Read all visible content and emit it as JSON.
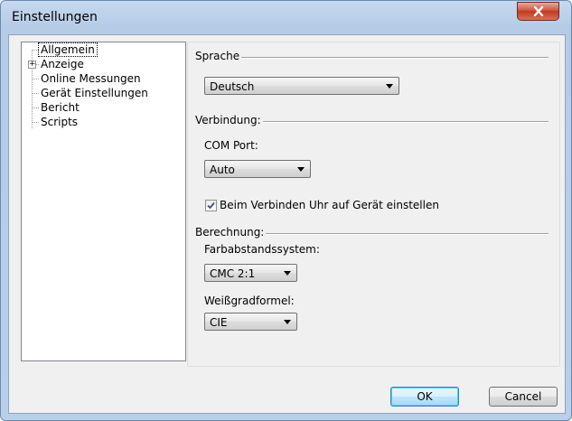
{
  "window": {
    "title": "Einstellungen",
    "close_glyph": "x-icon"
  },
  "tree": {
    "items": [
      {
        "label": "Allgemein",
        "selected": true
      },
      {
        "label": "Anzeige",
        "expandable": true,
        "expander": "+"
      },
      {
        "label": "Online Messungen"
      },
      {
        "label": "Gerät Einstellungen"
      },
      {
        "label": "Bericht"
      },
      {
        "label": "Scripts"
      }
    ]
  },
  "sprache": {
    "group_label": "Sprache",
    "value": "Deutsch"
  },
  "verbindung": {
    "group_label": "Verbindung:",
    "com_port_label": "COM Port:",
    "com_port_value": "Auto",
    "sync_clock_label": "Beim Verbinden Uhr auf Gerät einstellen",
    "sync_clock_checked": true
  },
  "berechnung": {
    "group_label": "Berechnung:",
    "farbabstand_label": "Farbabstandssystem:",
    "farbabstand_value": "CMC 2:1",
    "weissgrad_label": "Weißgradformel:",
    "weissgrad_value": "CIE"
  },
  "buttons": {
    "ok": "OK",
    "cancel": "Cancel"
  },
  "colors": {
    "close_button": "#c7452b",
    "default_button_border": "#3c7fb1"
  }
}
